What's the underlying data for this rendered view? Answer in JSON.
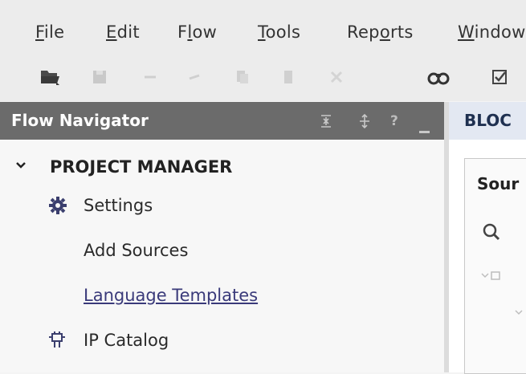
{
  "menu": {
    "file": {
      "mnemonic": "F",
      "rest": "ile"
    },
    "edit": {
      "mnemonic": "E",
      "rest": "dit"
    },
    "flow": {
      "pre": "F",
      "mnemonic": "l",
      "rest": "ow"
    },
    "tools": {
      "mnemonic": "T",
      "rest": "ools"
    },
    "reports": {
      "pre": "Rep",
      "mnemonic": "o",
      "rest": "rts"
    },
    "window": {
      "mnemonic": "W",
      "rest": "indow"
    }
  },
  "toolbar_icons": [
    "open-project-icon",
    "save-icon",
    "undo-icon",
    "redo-icon",
    "copy-icon",
    "paste-icon",
    "delete-icon",
    "find-icon",
    "checklist-icon"
  ],
  "flow_navigator": {
    "title": "Flow Navigator",
    "header_icons": [
      "collapse-all-icon",
      "expand-all-icon",
      "help-icon",
      "minimize-icon"
    ],
    "help_glyph": "?",
    "section": "PROJECT MANAGER",
    "items": [
      {
        "label": "Settings",
        "icon": "gear-icon"
      },
      {
        "label": "Add Sources"
      },
      {
        "label": "Language Templates"
      },
      {
        "label": "IP Catalog",
        "icon": "ip-chip-icon"
      }
    ]
  },
  "right_panel": {
    "tab_title": "BLOC",
    "sources_title": "Sour"
  },
  "colors": {
    "header_bg": "#6b6b6b",
    "link": "#3a3a7a",
    "accent_blue": "#e3e8f2"
  }
}
